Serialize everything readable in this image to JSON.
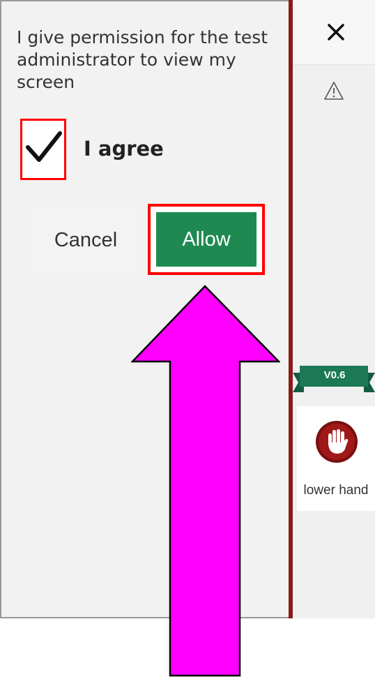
{
  "dialog": {
    "permission_text": "I give permission for the test administrator to view my screen",
    "agree_label": "I agree",
    "agree_checked": true,
    "cancel_label": "Cancel",
    "allow_label": "Allow"
  },
  "side_panel": {
    "close_icon": "close-icon",
    "warning_icon": "warning-icon",
    "version": "V0.6",
    "hand_label": "lower hand",
    "hand_icon": "raised-hand-icon"
  },
  "colors": {
    "allow_green": "#1e8a52",
    "highlight_red": "#ff0000",
    "divider_red": "#8b1a1a",
    "ribbon_green": "#1b7a55",
    "hand_red": "#a01818",
    "arrow_magenta": "#ff00ff"
  }
}
